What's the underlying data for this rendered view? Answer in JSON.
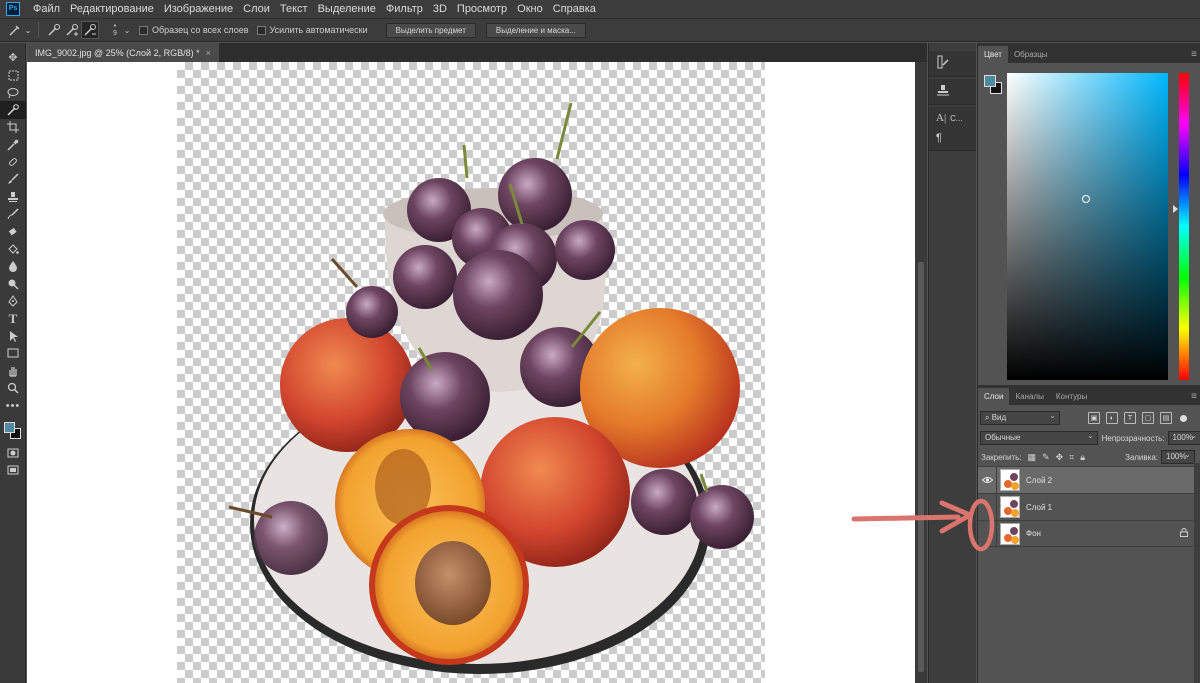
{
  "app": {
    "logo": "Ps"
  },
  "menu": [
    "Файл",
    "Редактирование",
    "Изображение",
    "Слои",
    "Текст",
    "Выделение",
    "Фильтр",
    "3D",
    "Просмотр",
    "Окно",
    "Справка"
  ],
  "options": {
    "brush_size": "9",
    "sample_all_layers": "Образец со всех слоев",
    "auto_enhance": "Усилить автоматически",
    "select_subject": "Выделить предмет",
    "select_and_mask": "Выделение и маска..."
  },
  "document": {
    "tab_title": "IMG_9002.jpg @ 25% (Слой 2, RGB/8) *",
    "close_glyph": "×"
  },
  "colors": {
    "foreground": "#4f8aa1",
    "background": "#111111",
    "annotation": "#d9746e"
  },
  "icons": {
    "dock": [
      "history-brush-icon",
      "clone-source-icon",
      "character-icon",
      "paragraph-icon"
    ],
    "tools": [
      "move-icon",
      "marquee-icon",
      "lasso-icon",
      "quick-selection-icon",
      "crop-icon",
      "eyedropper-icon",
      "healing-brush-icon",
      "brush-icon",
      "clone-stamp-icon",
      "history-brush-icon",
      "eraser-icon",
      "paint-bucket-icon",
      "blur-icon",
      "dodge-icon",
      "pen-icon",
      "type-icon",
      "path-selection-icon",
      "rectangle-icon",
      "hand-icon",
      "zoom-icon",
      "more-tools-icon"
    ]
  },
  "dock": {
    "char_label": "С..."
  },
  "color_panel": {
    "tabs": [
      "Цвет",
      "Образцы"
    ]
  },
  "layers_panel": {
    "tabs": [
      "Слои",
      "Каналы",
      "Контуры"
    ],
    "filter_kind": "Вид",
    "blend_mode": "Обычные",
    "opacity_label": "Непрозрачность:",
    "opacity_value": "100%",
    "lock_label": "Закрепить:",
    "fill_label": "Заливка:",
    "fill_value": "100%",
    "layers": [
      {
        "name": "Слой 2",
        "visible": true,
        "selected": true,
        "locked": false
      },
      {
        "name": "Слой 1",
        "visible": false,
        "selected": false,
        "locked": false
      },
      {
        "name": "Фон",
        "visible": false,
        "selected": false,
        "locked": true
      }
    ]
  }
}
